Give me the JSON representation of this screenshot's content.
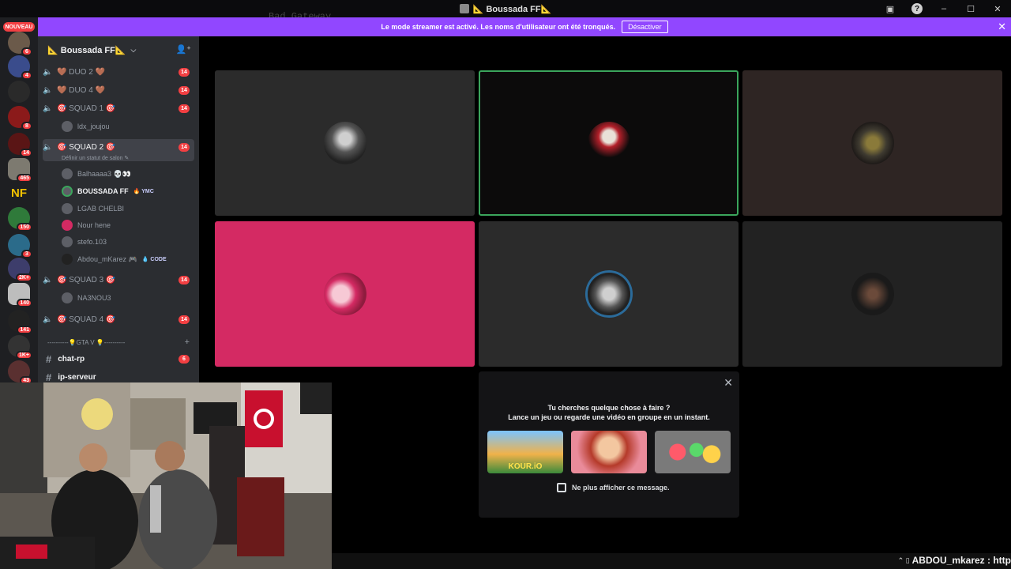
{
  "window": {
    "title": "📐 Boussada FF📐"
  },
  "banner": {
    "text": "Le mode streamer est activé. Les noms d'utilisateur ont été tronqués.",
    "button": "Désactiver",
    "close": "✕"
  },
  "ghost_text": "Bad Gateway",
  "rail": {
    "new_label": "NOUVEAU",
    "badges": [
      "6",
      "4",
      "8",
      "14",
      "465",
      "150",
      "3",
      "2K+",
      "140",
      "141",
      "1K+",
      "43"
    ],
    "nf_label": "NF"
  },
  "guild": {
    "name": "📐 Boussada FF📐",
    "chevron": "⌵"
  },
  "channels": {
    "duo2": {
      "name": "🤎 DUO 2 🤎",
      "badge": "14"
    },
    "duo4": {
      "name": "🤎 DUO 4 🤎",
      "badge": "14"
    },
    "squad1": {
      "name": "🎯 SQUAD 1 🎯",
      "badge": "14"
    },
    "squad1_member": "ldx_joujou",
    "squad2": {
      "name": "🎯 SQUAD 2 🎯",
      "badge": "14",
      "status": "Définir un statut de salon ✎"
    },
    "squad2_members": [
      {
        "name": "Balhaaaa3 💀👀",
        "tag": ""
      },
      {
        "name": "BOUSSADA FF",
        "tag": "🔥 YMC"
      },
      {
        "name": "LGAB CHELBI",
        "tag": ""
      },
      {
        "name": "Nour hene",
        "tag": ""
      },
      {
        "name": "stefo.103",
        "tag": ""
      },
      {
        "name": "Abdou_mKarez 🎮",
        "tag": "💧 CODE"
      }
    ],
    "squad3": {
      "name": "🎯 SQUAD 3 🎯",
      "badge": "14"
    },
    "squad3_member": "NA3NOU3",
    "squad4": {
      "name": "🎯 SQUAD 4 🎯",
      "badge": "14"
    },
    "category": "----------💡GTA V 💡----------",
    "text_channels": [
      {
        "name": "chat-rp",
        "badge": "6"
      },
      {
        "name": "ip-serveur",
        "badge": ""
      }
    ]
  },
  "activity": {
    "line1": "Tu cherches quelque chose à faire ?",
    "line2": "Lance un jeu ou regarde une vidéo en groupe en un instant.",
    "games": [
      "KOUR.iO",
      "",
      ""
    ],
    "checkbox_label": "Ne plus afficher ce message."
  },
  "taskbar": {
    "ticker": "ABDOU_mkarez : http"
  },
  "colors": {
    "accent_purple": "#9147ff",
    "badge_red": "#f23f42",
    "speaking_green": "#3ba55c",
    "pink_tile": "#d42a63"
  }
}
